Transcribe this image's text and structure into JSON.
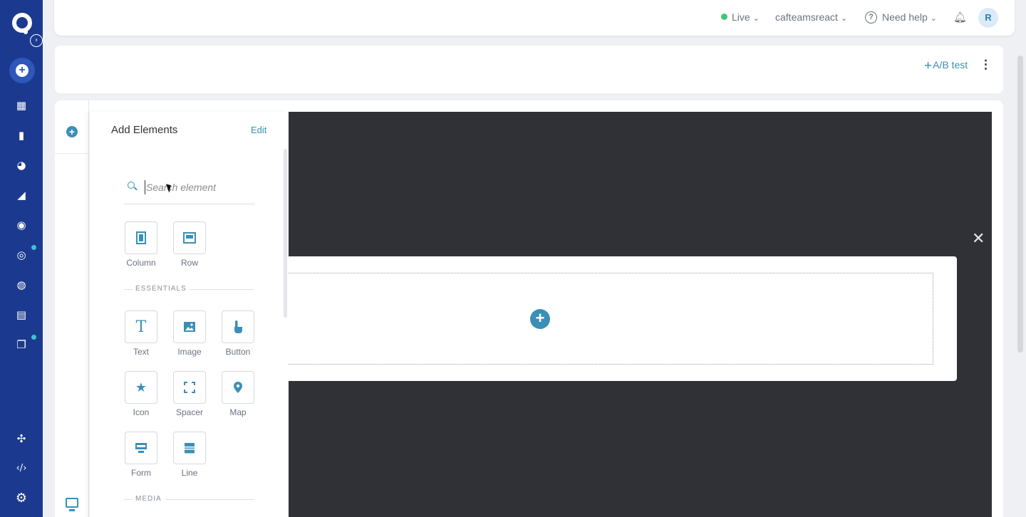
{
  "header": {
    "live_label": "Live",
    "account_label": "cafteamsreact",
    "help_label": "Need help",
    "avatar_initial": "R"
  },
  "actionbar": {
    "ab_test_label": "A/B test"
  },
  "panel": {
    "title": "Add Elements",
    "edit_label": "Edit",
    "search_placeholder": "Search element",
    "layout_items": [
      {
        "label": "Column",
        "icon": "column-icon"
      },
      {
        "label": "Row",
        "icon": "row-icon"
      }
    ],
    "essentials_heading": "ESSENTIALS",
    "essentials": [
      {
        "label": "Text",
        "icon": "text-icon"
      },
      {
        "label": "Image",
        "icon": "image-icon"
      },
      {
        "label": "Button",
        "icon": "pointer-icon"
      },
      {
        "label": "Icon",
        "icon": "star-icon"
      },
      {
        "label": "Spacer",
        "icon": "spacer-icon"
      },
      {
        "label": "Map",
        "icon": "map-pin-icon"
      },
      {
        "label": "Form",
        "icon": "form-icon"
      },
      {
        "label": "Line",
        "icon": "line-icon"
      }
    ],
    "media_heading": "MEDIA"
  },
  "colors": {
    "rail": "#1b3a8f",
    "accent": "#3b8fb7",
    "canvas": "#2f3136",
    "live": "#3fc775"
  }
}
